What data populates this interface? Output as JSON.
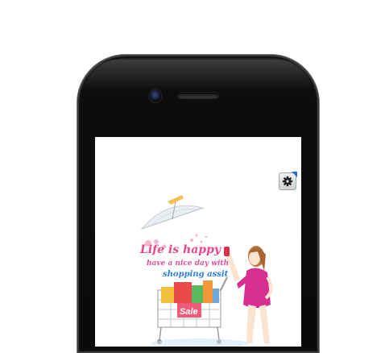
{
  "screen": {
    "tagline_line1": "Life is happy",
    "tagline_line2": "have a nice day with",
    "tagline_line3": "shopping assit",
    "sale_tag": "Sale"
  },
  "icons": {
    "settings": "gear-icon"
  },
  "colors": {
    "phone_body": "#0a0a0a",
    "tagline_pink": "#e8458a",
    "tagline_blue": "#2f7fd8",
    "dress": "#d62f8f",
    "settings_corner": "#1f6fd6"
  }
}
